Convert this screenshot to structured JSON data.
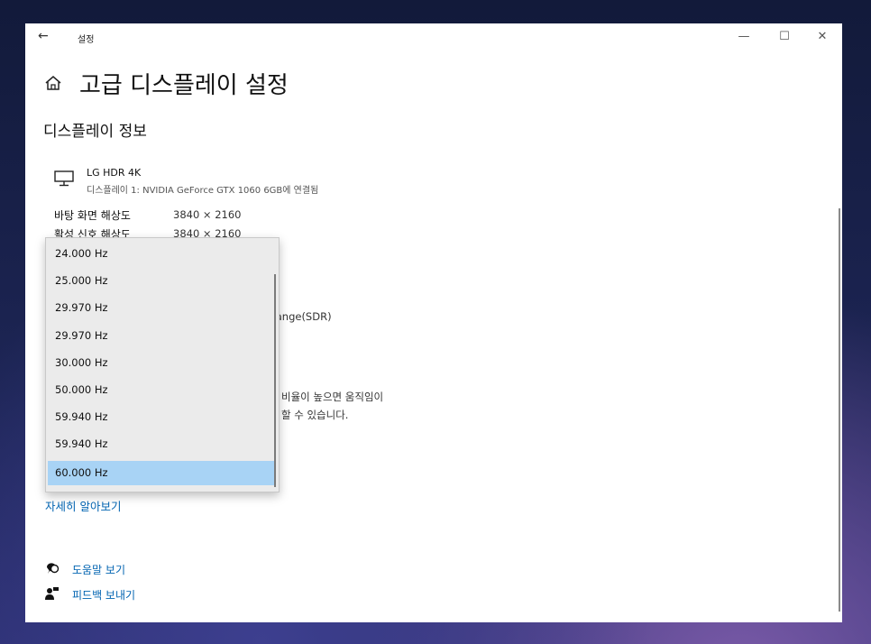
{
  "window": {
    "app_title": "설정",
    "back_glyph": "←",
    "minimize_glyph": "—",
    "maximize_glyph": "☐",
    "close_glyph": "✕"
  },
  "page": {
    "title": "고급 디스플레이 설정",
    "section_title": "디스플레이 정보"
  },
  "monitor": {
    "name": "LG HDR 4K",
    "subtitle": "디스플레이 1: NVIDIA GeForce GTX 1060 6GB에 연결됨"
  },
  "info": [
    {
      "label": "바탕 화면 해상도",
      "value": "3840 × 2160"
    },
    {
      "label": "활성 신호 해상도",
      "value": "3840 × 2160"
    }
  ],
  "partial_text": {
    "color_space": "Range(SDR)",
    "refresh_desc_line1": "비율이 높으면 움직임이",
    "refresh_desc_line2": "할 수 있습니다."
  },
  "learn_more": "자세히 알아보기",
  "help": {
    "get_help": "도움말 보기",
    "feedback": "피드백 보내기"
  },
  "dropdown": {
    "options": [
      "24.000 Hz",
      "25.000 Hz",
      "29.970 Hz",
      "29.970 Hz",
      "30.000 Hz",
      "50.000 Hz",
      "59.940 Hz",
      "59.940 Hz",
      "60.000 Hz"
    ],
    "selected_index": 8
  },
  "colors": {
    "accent": "#0063b1",
    "selected_bg": "#a8d3f5",
    "dropdown_bg": "#ebebeb"
  },
  "icons": {
    "home": "home-icon",
    "monitor": "monitor-icon",
    "help": "help-icon",
    "feedback": "feedback-icon"
  }
}
